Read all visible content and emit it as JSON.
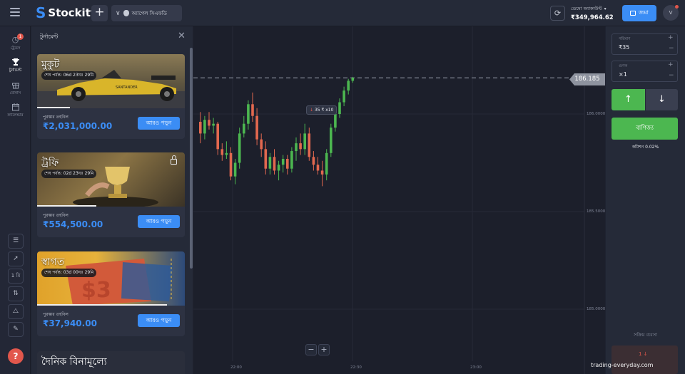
{
  "app": {
    "name": "Stockity",
    "logo_mark": "S"
  },
  "topbar": {
    "add_tab": "+",
    "asset_tab": {
      "chevron": "∨",
      "icon": "apple-icon",
      "label": "অ্যাপেল সিএফডি"
    },
    "sync_icon": "⟳",
    "account": {
      "type": "ডেমো অ্যাকাউন্ট",
      "dropdown": "▾",
      "balance": "₹349,964.62"
    },
    "deposit_label": "জমা",
    "avatar_letter": "V"
  },
  "rail": {
    "items": [
      {
        "label": "ট্রেডস",
        "icon": "clock-icon",
        "glyph": "◷",
        "badge": "1"
      },
      {
        "label": "টুর্নামেন্ট",
        "icon": "trophy-icon",
        "glyph": "🏆"
      },
      {
        "label": "বোনাস",
        "icon": "gift-icon",
        "glyph": "▣"
      },
      {
        "label": "ক্যালেন্ডার",
        "icon": "calendar-icon",
        "glyph": "▦"
      }
    ],
    "tools": [
      {
        "name": "chart-layout-icon",
        "glyph": "☰"
      },
      {
        "name": "rocket-icon",
        "glyph": "➚"
      },
      {
        "name": "timeframe-button",
        "glyph": "1 মি"
      },
      {
        "name": "indicators-icon",
        "glyph": "⇅"
      },
      {
        "name": "drawing-tools-icon",
        "glyph": "⧍"
      },
      {
        "name": "pencil-icon",
        "glyph": "✎"
      }
    ],
    "help": "?"
  },
  "tournaments": {
    "title": "টুর্নামেন্ট",
    "close": "✕",
    "cards": [
      {
        "name": "মুকুট",
        "timer": "শেষ পর্যন্ত: 06d 23ঘঃ 29মি",
        "pool_label": "পুরস্কার তহবিল",
        "amount": "₹2,031,000.00",
        "more": "আরও পড়ুন",
        "progress": 0.22,
        "locked": false,
        "theme": "car"
      },
      {
        "name": "ট্রফি",
        "timer": "শেষ পর্যন্ত: 02d 23ঘঃ 29মি",
        "pool_label": "পুরস্কার তহবিল",
        "amount": "₹554,500.00",
        "more": "আরও পড়ুন",
        "progress": 0.4,
        "locked": true,
        "theme": "trophy"
      },
      {
        "name": "স্বাগত",
        "timer": "শেষ পর্যন্ত: 03d 00ঘঃ 29মি",
        "pool_label": "পুরস্কার তহবিল",
        "amount": "₹37,940.00",
        "more": "আরও পড়ুন",
        "progress": 0.88,
        "locked": false,
        "theme": "ticket"
      }
    ],
    "card4_name": "দৈনিক বিনামূল্যে"
  },
  "chart": {
    "current_price": "186.185",
    "y_ticks": [
      "186.0000",
      "185.5000",
      "185.0000"
    ],
    "x_ticks": [
      "22:00",
      "22:30",
      "23:00"
    ],
    "deal_marker": {
      "arrow": "↓",
      "amount": "35 ₹",
      "mult": "x10"
    },
    "zoom_minus": "−",
    "zoom_plus": "+",
    "colors": {
      "up": "#4cb750",
      "down": "#e2684f"
    },
    "candles": [
      {
        "o": 185.96,
        "h": 186.01,
        "l": 185.85,
        "c": 185.9
      },
      {
        "o": 185.9,
        "h": 185.99,
        "l": 185.87,
        "c": 185.97
      },
      {
        "o": 185.97,
        "h": 186.01,
        "l": 185.92,
        "c": 185.94
      },
      {
        "o": 185.94,
        "h": 185.98,
        "l": 185.9,
        "c": 185.95
      },
      {
        "o": 185.95,
        "h": 185.96,
        "l": 185.79,
        "c": 185.82
      },
      {
        "o": 185.82,
        "h": 185.85,
        "l": 185.76,
        "c": 185.79
      },
      {
        "o": 185.79,
        "h": 185.86,
        "l": 185.77,
        "c": 185.8
      },
      {
        "o": 185.8,
        "h": 185.83,
        "l": 185.66,
        "c": 185.68
      },
      {
        "o": 185.68,
        "h": 185.77,
        "l": 185.64,
        "c": 185.75
      },
      {
        "o": 185.75,
        "h": 185.93,
        "l": 185.72,
        "c": 185.9
      },
      {
        "o": 185.9,
        "h": 185.99,
        "l": 185.88,
        "c": 185.95
      },
      {
        "o": 185.95,
        "h": 186.07,
        "l": 185.92,
        "c": 186.05
      },
      {
        "o": 186.05,
        "h": 186.11,
        "l": 185.96,
        "c": 185.99
      },
      {
        "o": 185.99,
        "h": 186.03,
        "l": 185.84,
        "c": 185.87
      },
      {
        "o": 185.87,
        "h": 185.9,
        "l": 185.78,
        "c": 185.82
      },
      {
        "o": 185.82,
        "h": 185.86,
        "l": 185.69,
        "c": 185.72
      },
      {
        "o": 185.72,
        "h": 185.8,
        "l": 185.69,
        "c": 185.78
      },
      {
        "o": 185.78,
        "h": 185.82,
        "l": 185.69,
        "c": 185.71
      },
      {
        "o": 185.71,
        "h": 185.76,
        "l": 185.66,
        "c": 185.74
      },
      {
        "o": 185.74,
        "h": 185.79,
        "l": 185.7,
        "c": 185.77
      },
      {
        "o": 185.77,
        "h": 185.79,
        "l": 185.69,
        "c": 185.72
      },
      {
        "o": 185.72,
        "h": 185.83,
        "l": 185.7,
        "c": 185.81
      },
      {
        "o": 185.81,
        "h": 185.88,
        "l": 185.76,
        "c": 185.85
      },
      {
        "o": 185.85,
        "h": 185.9,
        "l": 185.79,
        "c": 185.82
      },
      {
        "o": 185.82,
        "h": 185.95,
        "l": 185.79,
        "c": 185.9
      },
      {
        "o": 185.9,
        "h": 185.93,
        "l": 185.76,
        "c": 185.78
      },
      {
        "o": 185.78,
        "h": 185.81,
        "l": 185.71,
        "c": 185.74
      },
      {
        "o": 185.74,
        "h": 185.78,
        "l": 185.69,
        "c": 185.71
      },
      {
        "o": 185.71,
        "h": 185.76,
        "l": 185.63,
        "c": 185.69
      },
      {
        "o": 185.69,
        "h": 185.82,
        "l": 185.66,
        "c": 185.8
      },
      {
        "o": 185.8,
        "h": 185.95,
        "l": 185.78,
        "c": 185.93
      },
      {
        "o": 185.93,
        "h": 186.03,
        "l": 185.91,
        "c": 186.0
      },
      {
        "o": 186.0,
        "h": 186.08,
        "l": 185.98,
        "c": 186.06
      },
      {
        "o": 186.06,
        "h": 186.14,
        "l": 186.04,
        "c": 186.12
      },
      {
        "o": 186.12,
        "h": 186.18,
        "l": 186.1,
        "c": 186.17
      },
      {
        "o": 186.17,
        "h": 186.19,
        "l": 186.16,
        "c": 186.185
      }
    ]
  },
  "trade": {
    "investment_label": "পরিমাণ",
    "investment_value": "₹35",
    "multiplier_label": "গুণক",
    "multiplier_value": "×1",
    "plus": "+",
    "minus": "−",
    "up_arrow": "↑",
    "down_arrow": "↓",
    "trade_button": "বাণিজ্য",
    "commission": "কমিশন 0.02%",
    "active_label": "সক্রিয় ব্যবসা",
    "active_trade": "1 ↓"
  },
  "watermark": "trading-everyday.com"
}
